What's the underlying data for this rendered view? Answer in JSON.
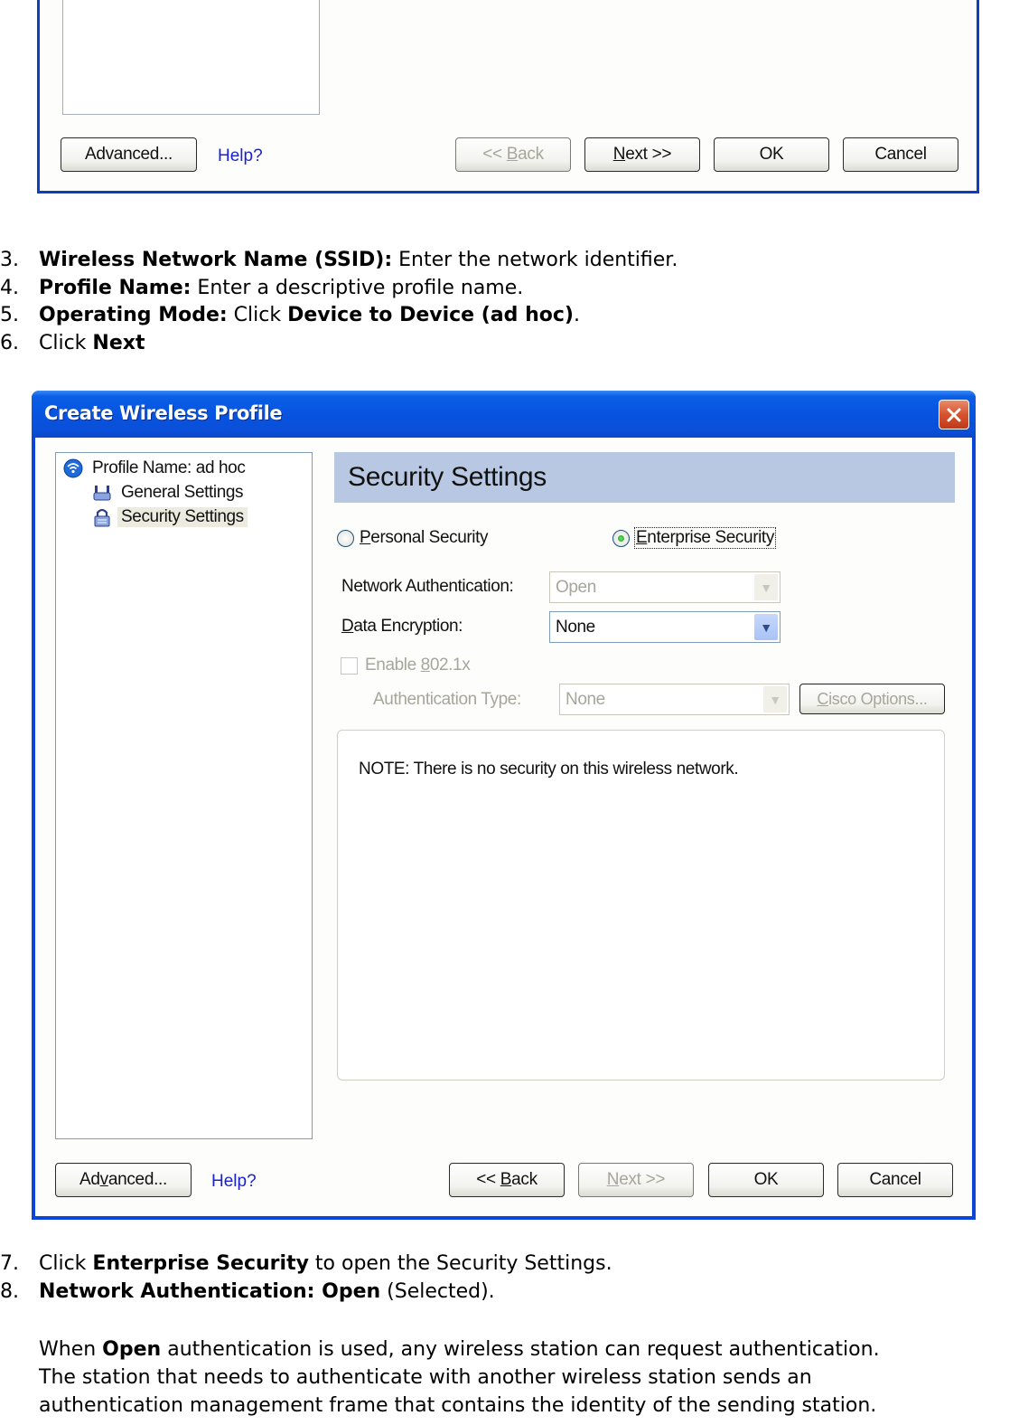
{
  "top_dialog": {
    "buttons": {
      "advanced": "Advanced...",
      "help": "Help?",
      "back": "<< Back",
      "next": "Next >>",
      "ok": "OK",
      "cancel": "Cancel"
    },
    "states": {
      "back_enabled": false,
      "next_enabled": true
    }
  },
  "steps_a": [
    {
      "num": "3.",
      "bold": "Wireless Network Name (SSID):",
      "text": " Enter the network identifier."
    },
    {
      "num": "4.",
      "bold": "Profile Name:",
      "text": " Enter a descriptive profile name."
    },
    {
      "num": "5.",
      "bold": "Operating Mode:",
      "text": " Click ",
      "bold2": "Device to Device (ad hoc)",
      "text2": "."
    },
    {
      "num": "6.",
      "text_pre": "Click ",
      "bold": "Next"
    }
  ],
  "dialog": {
    "title": "Create Wireless Profile",
    "tree": [
      {
        "label": "Profile Name: ad hoc",
        "icon": "wireless-network-icon"
      },
      {
        "label": "General Settings",
        "icon": "router-icon"
      },
      {
        "label": "Security Settings",
        "icon": "lock-icon",
        "selected": true
      }
    ],
    "section_title": "Security Settings",
    "radios": {
      "personal": "Personal Security",
      "enterprise": "Enterprise Security",
      "selected": "enterprise"
    },
    "network_auth": {
      "label": "Network Authentication:",
      "value": "Open",
      "enabled": false
    },
    "data_encryption": {
      "label": "Data Encryption:",
      "value": "None",
      "enabled": true
    },
    "enable_8021x": {
      "label": "Enable 802.1x",
      "checked": false,
      "enabled": false
    },
    "auth_type": {
      "label": "Authentication Type:",
      "value": "None",
      "enabled": false
    },
    "cisco_options": "Cisco Options...",
    "note": "NOTE: There is no security on this wireless network.",
    "buttons": {
      "advanced": "Advanced...",
      "help": "Help?",
      "back": "<< Back",
      "next": "Next >>",
      "ok": "OK",
      "cancel": "Cancel"
    },
    "states": {
      "back_enabled": true,
      "next_enabled": false
    }
  },
  "steps_b": [
    {
      "num": "7.",
      "text_pre": "Click ",
      "bold": "Enterprise Security",
      "text": " to open the Security Settings."
    },
    {
      "num": "8.",
      "bold": "Network Authentication: Open",
      "text": " (Selected)."
    }
  ],
  "paragraph": {
    "pre": "When ",
    "bold": "Open",
    "line1_rest": " authentication is used, any wireless station can request authentication.",
    "line2": "The station that needs to authenticate with another wireless station sends an",
    "line3": "authentication management frame that contains the identity of the sending station."
  }
}
